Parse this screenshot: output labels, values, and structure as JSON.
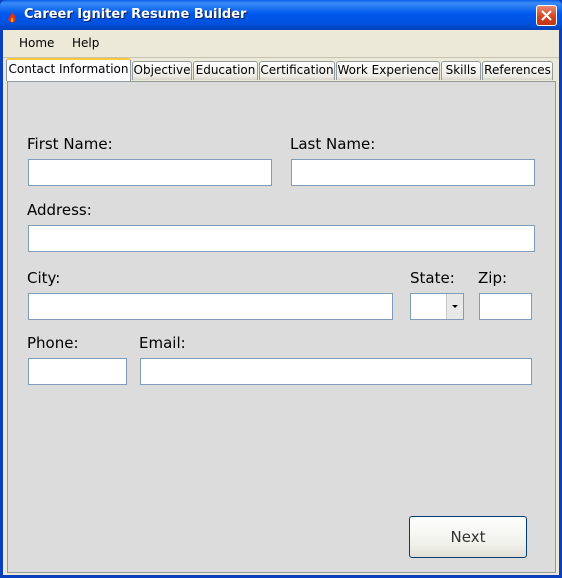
{
  "window": {
    "title": "Career Igniter Resume Builder",
    "icon": "app-icon",
    "close_icon": "close-icon"
  },
  "menu": {
    "items": [
      "Home",
      "Help"
    ]
  },
  "tabs": [
    {
      "label": "Contact Information",
      "active": true
    },
    {
      "label": "Objective",
      "active": false
    },
    {
      "label": "Education",
      "active": false
    },
    {
      "label": "Certification",
      "active": false
    },
    {
      "label": "Work Experience",
      "active": false
    },
    {
      "label": "Skills",
      "active": false
    },
    {
      "label": "References",
      "active": false
    }
  ],
  "form": {
    "first_name_label": "First Name:",
    "first_name_value": "",
    "last_name_label": "Last Name:",
    "last_name_value": "",
    "address_label": "Address:",
    "address_value": "",
    "city_label": "City:",
    "city_value": "",
    "state_label": "State:",
    "state_value": "",
    "zip_label": "Zip:",
    "zip_value": "",
    "phone_label": "Phone:",
    "phone_value": "",
    "email_label": "Email:",
    "email_value": ""
  },
  "actions": {
    "next_label": "Next"
  }
}
